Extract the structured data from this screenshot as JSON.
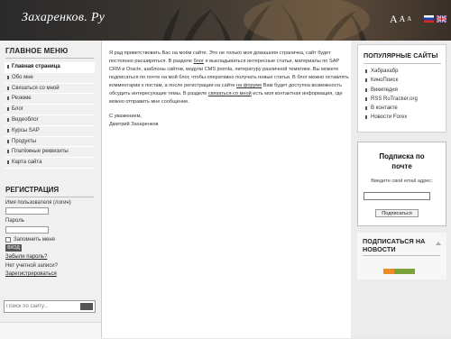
{
  "header": {
    "title": "Захаренков. Ру",
    "font_controls": [
      "A",
      "A",
      "A"
    ],
    "languages": [
      "ru-flag",
      "uk-flag"
    ]
  },
  "left": {
    "menu_title": "ГЛАВНОЕ МЕНЮ",
    "menu_items": [
      "Главная страница",
      "Обо мне",
      "Связаться со мной",
      "Резюме",
      "Блог",
      "Видеоблог",
      "Курсы SAP",
      "Продукты",
      "Платёжные реквизиты",
      "Карта сайта"
    ],
    "registration_title": "РЕГИСТРАЦИЯ",
    "username_label": "Имя пользователя (логин)",
    "password_label": "Пароль",
    "remember_label": "Запомнить меня",
    "login_button": "ВХОД",
    "forgot_password": "Забыли пароль?",
    "no_account": "Нет учетной записи?",
    "register_link": "Зарегистрироваться",
    "search_placeholder": "Поиск по сайту..."
  },
  "main": {
    "para1": {
      "t1": "Я рад приветствовать Вас на моём сайте. Это не только моя домашняя страничка, сайт будет постоянно расширяться. В разделе ",
      "link1": "блог",
      "t2": " я выкладываться интересные статьи, материалы по SAP CRM и Oracle,  шаблоны сайтов, модули CMS joomla, литературу различной тематики. Вы можете подписаться по почте на мой блог, чтобы оперативно получать новые статьи. В блог можно оставлять комментарии к постам, а после регистрации на сайте ",
      "link2": "на форуме",
      "t3": " Вам будет доступна возможность обсудить интересующие темы. В разделе ",
      "link3": "связаться со мной",
      "t4": " есть моя контактная информация, где можно отправить мне сообщение."
    },
    "regards": "С уважением,",
    "signature": "Дмитрий Захаренков"
  },
  "right": {
    "popular_title": "ПОПУЛЯРНЫЕ САЙТЫ",
    "popular_items": [
      "Хабрахабр",
      "КиноПоиск",
      "Википедия",
      "RSS RuTracker.org",
      "В контакте",
      "Новости Forex"
    ],
    "subscribe_title": "Подписка по почте",
    "subscribe_label": "Введите свой email адрес:",
    "subscribe_button": "Подписаться",
    "news_title": "ПОДПИСАТЬСЯ НА НОВОСТИ"
  },
  "colors": {
    "header_bg": "#3a3530",
    "sidebar_bg": "#f0f0f0",
    "content_bg": "#ffffff",
    "rss_orange": "#f08a24",
    "rss_green": "#7aa33a"
  }
}
